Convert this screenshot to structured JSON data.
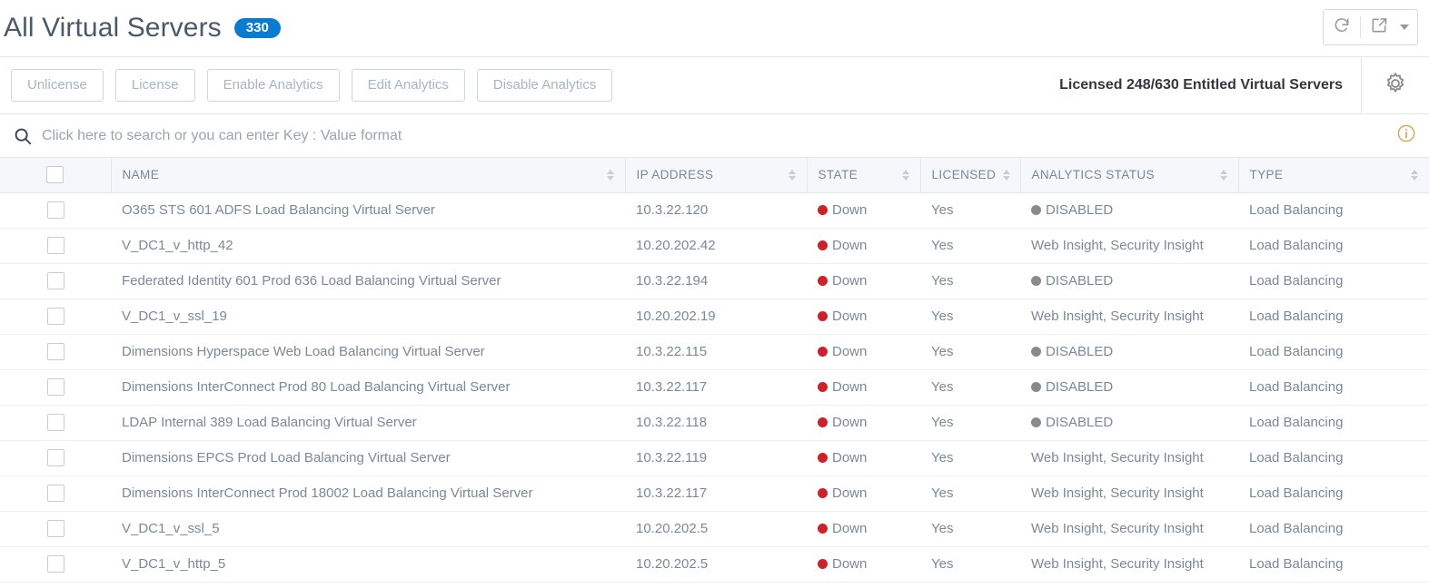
{
  "header": {
    "title": "All Virtual Servers",
    "count_badge": "330",
    "accent_color": "#0a7bd1",
    "refresh_icon": "refresh-icon",
    "export_icon": "export-icon"
  },
  "toolbar": {
    "buttons": [
      {
        "label": "Unlicense",
        "disabled": true
      },
      {
        "label": "License",
        "disabled": true
      },
      {
        "label": "Enable Analytics",
        "disabled": true
      },
      {
        "label": "Edit Analytics",
        "disabled": true
      },
      {
        "label": "Disable Analytics",
        "disabled": true
      }
    ],
    "license_info": "Licensed 248/630 Entitled Virtual Servers",
    "settings_icon": "gear-icon"
  },
  "search": {
    "placeholder": "Click here to search or you can enter Key : Value format",
    "value": "",
    "icon": "search-icon",
    "info_icon": "info-icon"
  },
  "table": {
    "columns": [
      {
        "key": "checkbox",
        "label": ""
      },
      {
        "key": "name",
        "label": "NAME"
      },
      {
        "key": "ip",
        "label": "IP ADDRESS"
      },
      {
        "key": "state",
        "label": "STATE"
      },
      {
        "key": "licensed",
        "label": "LICENSED"
      },
      {
        "key": "analytics",
        "label": "ANALYTICS STATUS"
      },
      {
        "key": "type",
        "label": "TYPE"
      }
    ],
    "rows": [
      {
        "name": "O365 STS 601 ADFS Load Balancing Virtual Server",
        "ip": "10.3.22.120",
        "state": "Down",
        "state_dot": "down",
        "licensed": "Yes",
        "analytics": "DISABLED",
        "analytics_dot": "disabled",
        "type": "Load Balancing"
      },
      {
        "name": "V_DC1_v_http_42",
        "ip": "10.20.202.42",
        "state": "Down",
        "state_dot": "down",
        "licensed": "Yes",
        "analytics": "Web Insight, Security Insight",
        "analytics_dot": "none",
        "type": "Load Balancing"
      },
      {
        "name": "Federated Identity 601 Prod 636 Load Balancing Virtual Server",
        "ip": "10.3.22.194",
        "state": "Down",
        "state_dot": "down",
        "licensed": "Yes",
        "analytics": "DISABLED",
        "analytics_dot": "disabled",
        "type": "Load Balancing"
      },
      {
        "name": "V_DC1_v_ssl_19",
        "ip": "10.20.202.19",
        "state": "Down",
        "state_dot": "down",
        "licensed": "Yes",
        "analytics": "Web Insight, Security Insight",
        "analytics_dot": "none",
        "type": "Load Balancing"
      },
      {
        "name": "Dimensions Hyperspace Web Load Balancing Virtual Server",
        "ip": "10.3.22.115",
        "state": "Down",
        "state_dot": "down",
        "licensed": "Yes",
        "analytics": "DISABLED",
        "analytics_dot": "disabled",
        "type": "Load Balancing"
      },
      {
        "name": "Dimensions InterConnect Prod 80 Load Balancing Virtual Server",
        "ip": "10.3.22.117",
        "state": "Down",
        "state_dot": "down",
        "licensed": "Yes",
        "analytics": "DISABLED",
        "analytics_dot": "disabled",
        "type": "Load Balancing"
      },
      {
        "name": "LDAP Internal 389 Load Balancing Virtual Server",
        "ip": "10.3.22.118",
        "state": "Down",
        "state_dot": "down",
        "licensed": "Yes",
        "analytics": "DISABLED",
        "analytics_dot": "disabled",
        "type": "Load Balancing"
      },
      {
        "name": "Dimensions EPCS Prod Load Balancing Virtual Server",
        "ip": "10.3.22.119",
        "state": "Down",
        "state_dot": "down",
        "licensed": "Yes",
        "analytics": "Web Insight, Security Insight",
        "analytics_dot": "none",
        "type": "Load Balancing"
      },
      {
        "name": "Dimensions InterConnect Prod 18002 Load Balancing Virtual Server",
        "ip": "10.3.22.117",
        "state": "Down",
        "state_dot": "down",
        "licensed": "Yes",
        "analytics": "Web Insight, Security Insight",
        "analytics_dot": "none",
        "type": "Load Balancing"
      },
      {
        "name": "V_DC1_v_ssl_5",
        "ip": "10.20.202.5",
        "state": "Down",
        "state_dot": "down",
        "licensed": "Yes",
        "analytics": "Web Insight, Security Insight",
        "analytics_dot": "none",
        "type": "Load Balancing"
      },
      {
        "name": "V_DC1_v_http_5",
        "ip": "10.20.202.5",
        "state": "Down",
        "state_dot": "down",
        "licensed": "Yes",
        "analytics": "Web Insight, Security Insight",
        "analytics_dot": "none",
        "type": "Load Balancing"
      }
    ]
  },
  "colors": {
    "status_down": "#cc2229",
    "status_disabled": "#8a8a8a",
    "badge": "#0a7bd1",
    "header_bg": "#f5f7fa"
  }
}
